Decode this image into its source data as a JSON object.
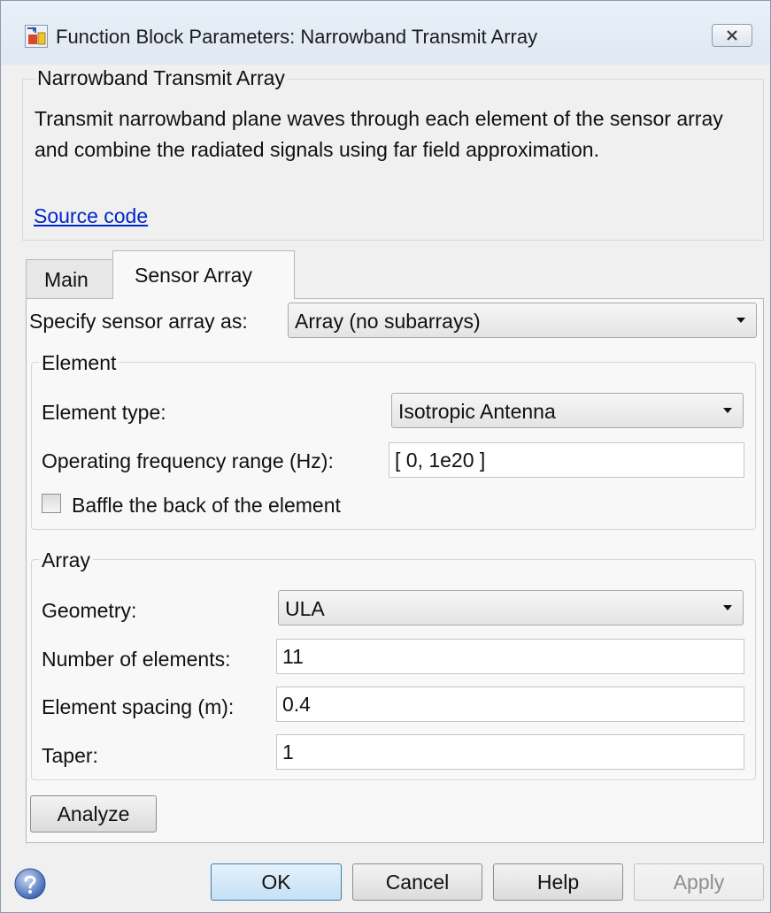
{
  "window": {
    "title": "Function Block Parameters: Narrowband Transmit Array",
    "icon": "simulink-block-icon"
  },
  "description": {
    "heading": "Narrowband Transmit Array",
    "text": "Transmit narrowband plane waves through each element of the sensor array and combine the radiated signals using far field approximation.",
    "link": "Source code"
  },
  "tabs": [
    {
      "label": "Main",
      "active": false
    },
    {
      "label": "Sensor Array",
      "active": true
    }
  ],
  "sensor": {
    "specify_label": "Specify sensor array as:",
    "specify_value": "Array (no subarrays)"
  },
  "element": {
    "group_title": "Element",
    "type_label": "Element type:",
    "type_value": "Isotropic Antenna",
    "freq_label": "Operating frequency range (Hz):",
    "freq_value": "[ 0, 1e20 ]",
    "baffle_label": "Baffle the back of the element",
    "baffle_checked": false
  },
  "array": {
    "group_title": "Array",
    "geometry_label": "Geometry:",
    "geometry_value": "ULA",
    "num_label": "Number of elements:",
    "num_value": "11",
    "spacing_label": "Element spacing (m):",
    "spacing_value": "0.4",
    "taper_label": "Taper:",
    "taper_value": "1"
  },
  "analyze_label": "Analyze",
  "buttons": {
    "ok": "OK",
    "cancel": "Cancel",
    "help": "Help",
    "apply": "Apply"
  },
  "colors": {
    "link": "#0026c9",
    "titlebar": "#dfe8f3",
    "ok_border": "#3c7fb1"
  }
}
